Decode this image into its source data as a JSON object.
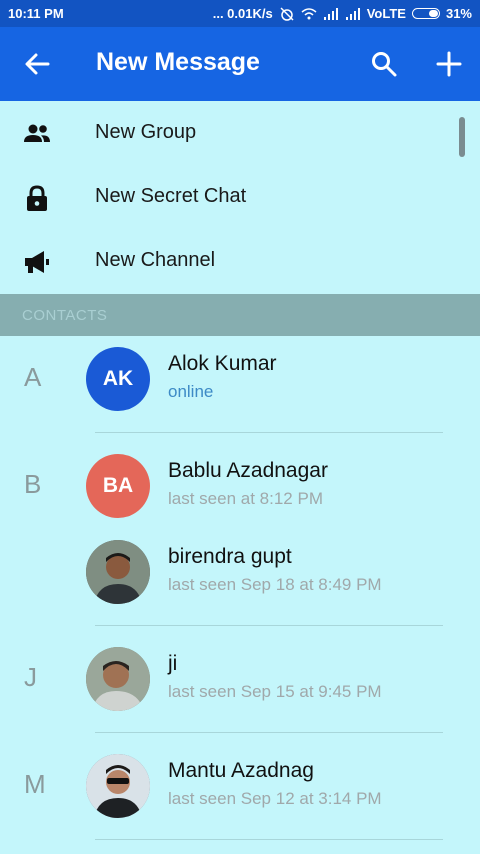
{
  "status_bar": {
    "time": "10:11 PM",
    "network_speed": "... 0.01K/s",
    "volte": "VoLTE",
    "battery": "31%"
  },
  "app_bar": {
    "title": "New Message"
  },
  "menu": [
    {
      "label": "New Group",
      "icon": "group-icon"
    },
    {
      "label": "New Secret Chat",
      "icon": "lock-icon"
    },
    {
      "label": "New Channel",
      "icon": "megaphone-icon"
    }
  ],
  "section_header": "CONTACTS",
  "contacts": [
    {
      "letter": "A",
      "initials": "AK",
      "name": "Alok Kumar",
      "status": "online",
      "avatar_color": "#1a5ad6"
    },
    {
      "letter": "B",
      "initials": "BA",
      "name": "Bablu Azadnagar",
      "status": "last seen at 8:12 PM",
      "avatar_color": "#e46759"
    },
    {
      "letter": "",
      "initials": "",
      "name": "birendra gupt",
      "status": "last seen Sep 18 at 8:49 PM",
      "avatar_color": "#4b5b5e"
    },
    {
      "letter": "J",
      "initials": "",
      "name": "ji",
      "status": "last seen Sep 15 at 9:45 PM",
      "avatar_color": "#6b7a6e"
    },
    {
      "letter": "M",
      "initials": "",
      "name": "Mantu Azadnag",
      "status": "last seen Sep 12 at 3:14 PM",
      "avatar_color": "#5c6f80"
    }
  ],
  "colors": {
    "status_bar": "#1254c2",
    "app_bar": "#1665e3",
    "background": "#c4f6fb",
    "section_header": "#86aeb0"
  }
}
